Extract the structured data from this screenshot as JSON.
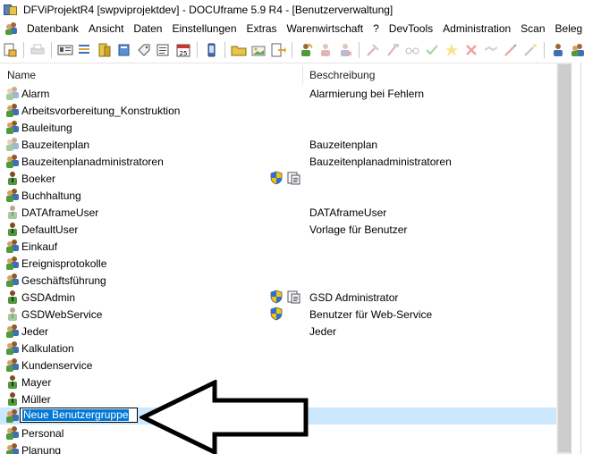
{
  "window": {
    "title": "DFViProjektR4 [swpviprojektdev] - DOCUframe 5.9 R4 - [Benutzerverwaltung]"
  },
  "menu": {
    "items": [
      "Datenbank",
      "Ansicht",
      "Daten",
      "Einstellungen",
      "Extras",
      "Warenwirtschaft",
      "?",
      "DevTools",
      "Administration",
      "Scan",
      "Beleg"
    ]
  },
  "list": {
    "columns": {
      "name": "Name",
      "description": "Beschreibung"
    },
    "rows": [
      {
        "name": "Alarm",
        "description": "Alarmierung bei Fehlern",
        "icon": "user-group-faded-icon"
      },
      {
        "name": "Arbeitsvorbereitung_Konstruktion",
        "description": "",
        "icon": "user-group-icon"
      },
      {
        "name": "Bauleitung",
        "description": "",
        "icon": "user-group-icon"
      },
      {
        "name": "Bauzeitenplan",
        "description": "Bauzeitenplan",
        "icon": "user-group-faded-icon"
      },
      {
        "name": "Bauzeitenplanadministratoren",
        "description": "Bauzeitenplanadministratoren",
        "icon": "user-group-icon"
      },
      {
        "name": "Boeker",
        "description": "",
        "icon": "user-icon",
        "shield": true,
        "doc": true
      },
      {
        "name": "Buchhaltung",
        "description": "",
        "icon": "user-group-icon"
      },
      {
        "name": "DATAframeUser",
        "description": "DATAframeUser",
        "icon": "user-faded-icon"
      },
      {
        "name": "DefaultUser",
        "description": "Vorlage für Benutzer",
        "icon": "user-icon"
      },
      {
        "name": "Einkauf",
        "description": "",
        "icon": "user-group-icon"
      },
      {
        "name": "Ereignisprotokolle",
        "description": "",
        "icon": "user-group-icon"
      },
      {
        "name": "Geschäftsführung",
        "description": "",
        "icon": "user-group-icon"
      },
      {
        "name": "GSDAdmin",
        "description": "GSD Administrator",
        "icon": "user-icon",
        "shield": true,
        "doc": true
      },
      {
        "name": "GSDWebService",
        "description": "Benutzer für Web-Service",
        "icon": "user-faded-icon",
        "shield": true
      },
      {
        "name": "Jeder",
        "description": "Jeder",
        "icon": "user-group-icon"
      },
      {
        "name": "Kalkulation",
        "description": "",
        "icon": "user-group-icon"
      },
      {
        "name": "Kundenservice",
        "description": "",
        "icon": "user-group-icon"
      },
      {
        "name": "Mayer",
        "description": "",
        "icon": "user-icon"
      },
      {
        "name": "Müller",
        "description": "",
        "icon": "user-icon"
      },
      {
        "name": "Neue Benutzergruppe",
        "description": "",
        "icon": "user-group-icon",
        "editing": true
      },
      {
        "name": "Personal",
        "description": "",
        "icon": "user-group-icon"
      },
      {
        "name": "Planung",
        "description": "",
        "icon": "user-group-icon"
      }
    ]
  },
  "colors": {
    "selection": "#cce8ff",
    "edit_highlight": "#0078d7"
  }
}
